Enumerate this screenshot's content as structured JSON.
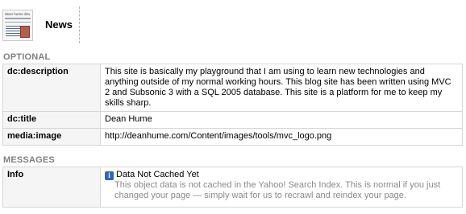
{
  "header": {
    "thumb_brand": "dean hume dev",
    "title": "News"
  },
  "sections": {
    "optional": "OPTIONAL",
    "messages": "MESSAGES"
  },
  "optional_rows": [
    {
      "key": "dc:description",
      "value": "This site is basically my playground that I am using to learn new technologies and anything outside of my normal working hours. This blog site has been written using MVC 2 and Subsonic 3 with a SQL 2005 database. This site is a platform for me to keep my skills sharp."
    },
    {
      "key": "dc:title",
      "value": "Dean Hume"
    },
    {
      "key": "media:image",
      "value": "http://deanhume.com/Content/images/tools/mvc_logo.png"
    }
  ],
  "messages": [
    {
      "key": "Info",
      "icon": "info-icon",
      "title": "Data Not Cached Yet",
      "body": "This object data is not cached in the Yahoo! Search Index. This is normal if you just changed your page — simply wait for us to recrawl and reindex your page."
    }
  ],
  "colors": {
    "section_label": "#7f7f7f",
    "key_cell_bg": "#f5f5f5",
    "border": "#d6d6d6",
    "info_icon": "#2f67b8",
    "message_body": "#8a8a8a"
  }
}
